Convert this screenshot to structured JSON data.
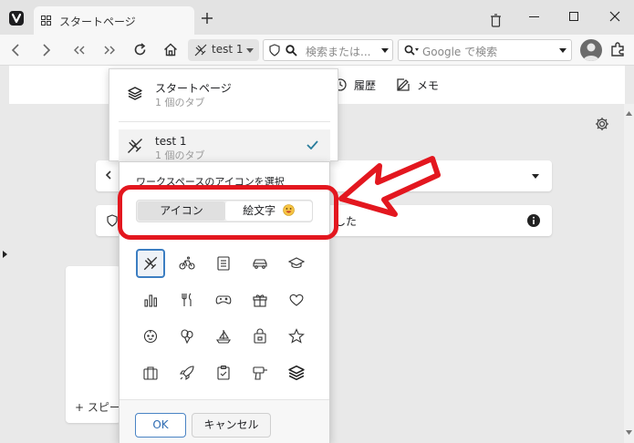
{
  "tab": {
    "title": "スタートページ"
  },
  "toolbar": {
    "workspace_label": "test 1",
    "url_placeholder": "検索または...",
    "search_placeholder": "Google で検索"
  },
  "page": {
    "history_label": "履歴",
    "memo_label": "メモ",
    "notice_text": "した",
    "speed_dial_add": "+ スピー"
  },
  "workspaces": [
    {
      "name": "スタートページ",
      "tabs": "1 個のタブ",
      "icon": "layers-icon"
    },
    {
      "name": "test 1",
      "tabs": "1 個のタブ",
      "icon": "airplane-icon",
      "active": true
    }
  ],
  "picker": {
    "title": "ワークスペースのアイコンを選択",
    "tab_icon": "アイコン",
    "tab_emoji": "絵文字",
    "ok": "OK",
    "cancel": "キャンセル",
    "icons": [
      "airplane-icon",
      "bicycle-icon",
      "notes-icon",
      "car-icon",
      "graduation-cap-icon",
      "bar-chart-icon",
      "fork-knife-icon",
      "gamepad-icon",
      "gift-icon",
      "heart-icon",
      "baby-face-icon",
      "balloons-icon",
      "sailboat-icon",
      "shopping-bag-icon",
      "star-icon",
      "briefcase-icon",
      "rocket-icon",
      "clipboard-check-icon",
      "drill-icon",
      "layers-icon"
    ],
    "selected_icon": "airplane-icon"
  },
  "colors": {
    "annotation": "#e3171f",
    "accent": "#3c7ec2"
  }
}
